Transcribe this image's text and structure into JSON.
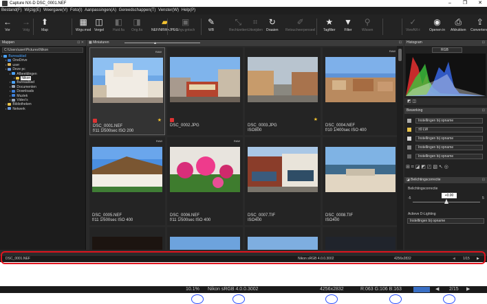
{
  "window": {
    "title": "Capture NX-D   DSC_0001.NEF",
    "controls": [
      "–",
      "❐",
      "✕"
    ]
  },
  "menu": [
    "Bestand(F)",
    "Wijzig(E)",
    "Weergave(V)",
    "Foto(I)",
    "Aanpassingen(A)",
    "Gereedschappen(T)",
    "Venster(W)",
    "Help(P)"
  ],
  "toolbar": {
    "items": [
      {
        "label": "Vor",
        "icon": "←"
      },
      {
        "label": "Volg",
        "icon": "→"
      },
      {
        "label": "Map",
        "icon": "⬆"
      },
      {
        "label": "Wrgv.mod",
        "icon": "▦"
      },
      {
        "label": "Vergel",
        "icon": "◫"
      },
      {
        "label": "Huid.fia",
        "icon": "◧"
      },
      {
        "label": "Orig.fia",
        "icon": "◨"
      },
      {
        "label": "NEF/NRW+JPEG",
        "icon": "▰"
      },
      {
        "label": "Wrgv.gntsch",
        "icon": "▣"
      },
      {
        "label": "WB",
        "icon": "✎"
      },
      {
        "label": "Rechtzetten",
        "icon": "⤡"
      },
      {
        "label": "Uitsnijden",
        "icon": "⌗"
      },
      {
        "label": "Draaien",
        "icon": "↻"
      },
      {
        "label": "Retoucheerpenseel",
        "icon": "✐"
      },
      {
        "label": "Tagfilter",
        "icon": "★"
      },
      {
        "label": "Filter",
        "icon": "▼"
      },
      {
        "label": "Wissen",
        "icon": "⚲"
      },
      {
        "label": "ViewNX-i",
        "icon": "✓"
      },
      {
        "label": "Openen in",
        "icon": "◉"
      },
      {
        "label": "Afdrukken",
        "icon": "⎙"
      },
      {
        "label": "Converteren",
        "icon": "⇪"
      }
    ]
  },
  "left_panel": {
    "title": "Mappen",
    "path": "C:\\Users\\user\\Pictures\\Nikon",
    "tree": [
      {
        "label": "Bureaublad",
        "indent": 0,
        "color": "#4aa3ff",
        "blue": true
      },
      {
        "label": "OneDrive",
        "indent": 1,
        "color": "#3d7fd9"
      },
      {
        "label": "user",
        "indent": 1,
        "color": "#d8b25a"
      },
      {
        "label": "Deze pc",
        "indent": 1,
        "color": "#6b9be0"
      },
      {
        "label": "Afbeeldingen",
        "indent": 2,
        "color": "#4aa3ff"
      },
      {
        "label": "Nikon",
        "indent": 3,
        "color": "#e8c34a",
        "selected": true
      },
      {
        "label": "Bureaublad",
        "indent": 2,
        "color": "#4aa3ff"
      },
      {
        "label": "Documenten",
        "indent": 2,
        "color": "#9aa6b8"
      },
      {
        "label": "Downloads",
        "indent": 2,
        "color": "#3d7fd9"
      },
      {
        "label": "Muziek",
        "indent": 2,
        "color": "#3d7fd9"
      },
      {
        "label": "Video's",
        "indent": 2,
        "color": "#9aa6b8"
      },
      {
        "label": "Bibliotheken",
        "indent": 1,
        "color": "#e8c34a"
      },
      {
        "label": "Netwerk",
        "indent": 1,
        "color": "#6b9be0"
      }
    ]
  },
  "center_panel": {
    "title": "Miniaturen",
    "thumbnails": [
      {
        "name": "DSC_0001.NEF",
        "info": "f/11 1/500sec ISO 200",
        "raw": "RAW",
        "flag": true,
        "star": true,
        "selected": true,
        "scene": "town"
      },
      {
        "name": "DSC_0002.JPG",
        "info": "",
        "raw": "",
        "flag": true,
        "star": false,
        "selected": false,
        "scene": "tram"
      },
      {
        "name": "DSC_0003.JPG",
        "info": "ISO800",
        "raw": "",
        "flag": false,
        "star": true,
        "selected": false,
        "scene": "street"
      },
      {
        "name": "DSC_0004.NEF",
        "info": "f/10 1/400sec ISO 400",
        "raw": "RAW",
        "flag": false,
        "star": false,
        "selected": false,
        "scene": "city"
      },
      {
        "name": "DSC_0005.NEF",
        "info": "f/11 1/500sec ISO 400",
        "raw": "RAW",
        "flag": false,
        "star": false,
        "selected": false,
        "scene": "cottage"
      },
      {
        "name": "DSC_0006.NEF",
        "info": "f/11 1/500sec ISO 400",
        "raw": "RAW",
        "flag": false,
        "star": false,
        "selected": false,
        "scene": "flowers"
      },
      {
        "name": "DSC_0007.TIF",
        "info": "ISO400",
        "raw": "",
        "flag": false,
        "star": false,
        "selected": false,
        "scene": "shops"
      },
      {
        "name": "DSC_0008.TIF",
        "info": "ISO400",
        "raw": "",
        "flag": false,
        "star": false,
        "selected": false,
        "scene": "sea"
      }
    ]
  },
  "right_panel": {
    "histogram_title": "Histogram",
    "histogram_channel": "RGB",
    "edit_title": "Bewerking",
    "edit_rows": [
      {
        "value": "Instellingen bij opname"
      },
      {
        "value": "±0 LW"
      },
      {
        "value": "Instellingen bij opname"
      },
      {
        "value": "Instellingen bij opname"
      },
      {
        "value": "Instellingen bij opname"
      }
    ],
    "exposure_title": "Belichtingscorrectie",
    "exposure_label": "Belichtingscorrectie",
    "exposure_value": "+0.00",
    "exposure_min": "-5",
    "exposure_max": "5",
    "dlighting_title": "Actieve D-Lighting",
    "dlighting_value": "Instellingen bij opname"
  },
  "status": {
    "filename": "DSC_0001.NEF",
    "profile": "Nikon sRGB 4.0.0.3002",
    "size": "4256x2832",
    "page": "1/15"
  },
  "zoom_bar": {
    "zoom": "10.1%",
    "profile": "Nikon sRGB 4.0.0.3002",
    "size": "4256x2832",
    "rgb": "R:063 G:106 B:163",
    "page": "2/15"
  }
}
